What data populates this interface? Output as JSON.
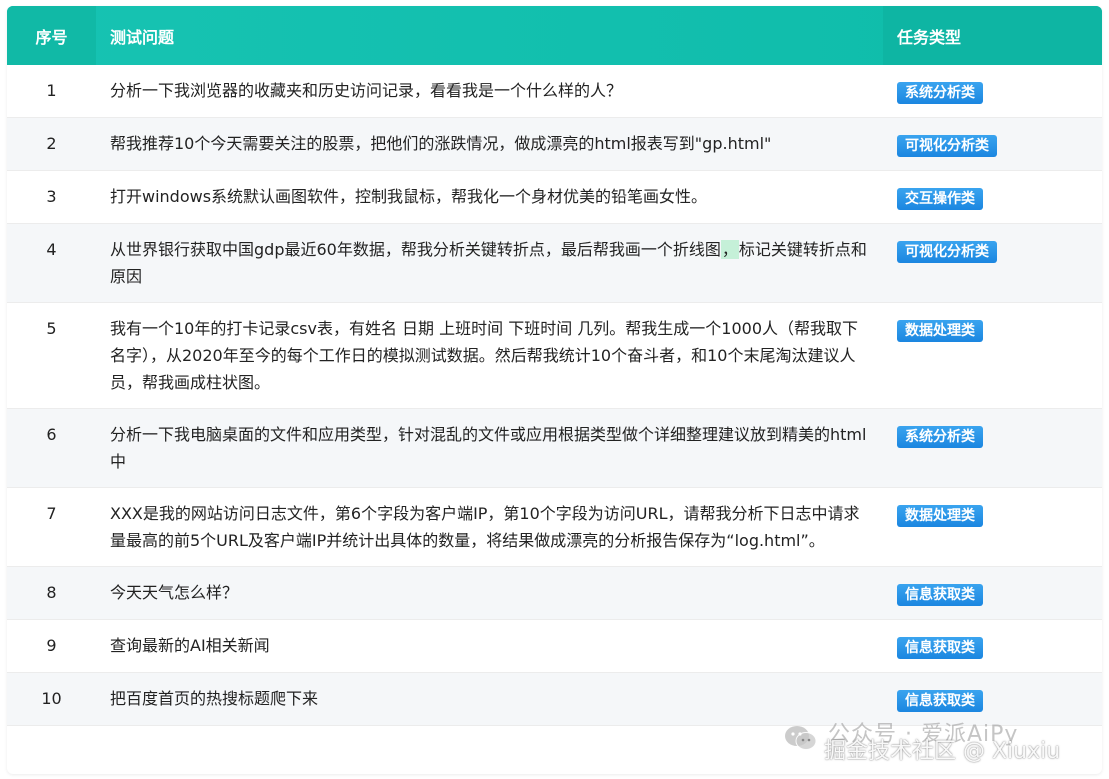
{
  "header": {
    "col_num": "序号",
    "col_question": "测试问题",
    "col_type": "任务类型"
  },
  "rows": [
    {
      "num": "1",
      "question": "分析一下我浏览器的收藏夹和历史访问记录，看看我是一个什么样的人？",
      "type": "系统分析类"
    },
    {
      "num": "2",
      "question": "帮我推荐10个今天需要关注的股票，把他们的涨跌情况，做成漂亮的html报表写到\"gp.html\"",
      "type": "可视化分析类"
    },
    {
      "num": "3",
      "question": "打开windows系统默认画图软件，控制我鼠标，帮我化一个身材优美的铅笔画女性。",
      "type": "交互操作类"
    },
    {
      "num": "4",
      "question_a": "从世界银行获取中国gdp最近60年数据，帮我分析关键转折点，最后帮我画一个折线图",
      "question_hl": "，",
      "question_b": "标记关键转折点和原因",
      "type": "可视化分析类"
    },
    {
      "num": "5",
      "question": "我有一个10年的打卡记录csv表，有姓名 日期 上班时间 下班时间 几列。帮我生成一个1000人（帮我取下名字），从2020年至今的每个工作日的模拟测试数据。然后帮我统计10个奋斗者，和10个末尾淘汰建议人员，帮我画成柱状图。",
      "type": "数据处理类"
    },
    {
      "num": "6",
      "question": "分析一下我电脑桌面的文件和应用类型，针对混乱的文件或应用根据类型做个详细整理建议放到精美的html中",
      "type": "系统分析类"
    },
    {
      "num": "7",
      "question": "XXX是我的网站访问日志文件，第6个字段为客户端IP，第10个字段为访问URL，请帮我分析下日志中请求量最高的前5个URL及客户端IP并统计出具体的数量，将结果做成漂亮的分析报告保存为“log.html”。",
      "type": "数据处理类"
    },
    {
      "num": "8",
      "question": "今天天气怎么样？",
      "type": "信息获取类"
    },
    {
      "num": "9",
      "question": "查询最新的AI相关新闻",
      "type": "信息获取类"
    },
    {
      "num": "10",
      "question": "把百度首页的热搜标题爬下来",
      "type": "信息获取类"
    }
  ],
  "watermark": {
    "line1": "公众号 · 爱派AiPy",
    "line2": "掘金技术社区 @ Xiuxiu"
  }
}
